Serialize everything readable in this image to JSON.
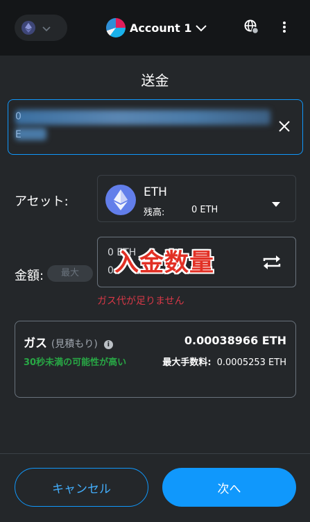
{
  "header": {
    "network_icon": "ethereum-icon",
    "account_name": "Account 1",
    "connection_icon": "globe-status-icon",
    "menu_icon": "kebab-menu-icon"
  },
  "page_title": "送金",
  "recipient": {
    "address_prefix_line1": "0",
    "address_prefix_line2": "E",
    "address_obscured": true
  },
  "asset": {
    "label": "アセット:",
    "name": "ETH",
    "balance_label": "残高:",
    "balance_value": "0 ETH"
  },
  "amount": {
    "label": "金額:",
    "max_label": "最大",
    "value_line1": "0 ETH",
    "value_line2": "0",
    "overlay_text": "入金数量",
    "error": "ガス代が足りません"
  },
  "gas": {
    "title": "ガス",
    "subtitle": "(見積もり)",
    "info_icon": "info-icon",
    "amount": "0.00038966 ETH",
    "likelihood": "30秒未満の可能性が高い",
    "max_fee_label": "最大手数料:",
    "max_fee_value": "0.0005253 ETH"
  },
  "footer": {
    "cancel_label": "キャンセル",
    "next_label": "次へ"
  },
  "colors": {
    "background": "#24272a",
    "header": "#141618",
    "accent": "#1098fc",
    "error": "#d73847",
    "success": "#28a745",
    "stamp": "#e23025"
  }
}
